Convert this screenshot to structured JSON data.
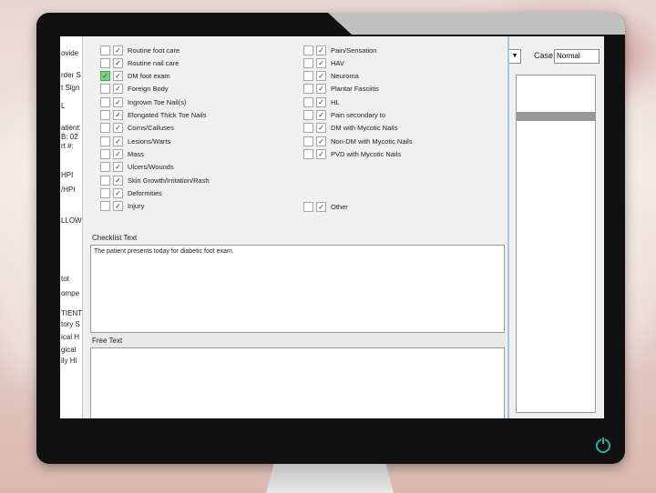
{
  "left_column": [
    {
      "label": "Routine foot care",
      "checked": true,
      "highlight": false
    },
    {
      "label": "Routine nail care",
      "checked": true,
      "highlight": false
    },
    {
      "label": "DM foot exam",
      "checked": true,
      "highlight": true
    },
    {
      "label": "Foreign Body",
      "checked": true,
      "highlight": false
    },
    {
      "label": "Ingrown Toe Nail(s)",
      "checked": true,
      "highlight": false
    },
    {
      "label": "Elongated Thick Toe Nails",
      "checked": true,
      "highlight": false
    },
    {
      "label": "Corns/Calluses",
      "checked": true,
      "highlight": false
    },
    {
      "label": "Lesions/Warts",
      "checked": true,
      "highlight": false
    },
    {
      "label": "Mass",
      "checked": true,
      "highlight": false
    },
    {
      "label": "Ulcers/Wounds",
      "checked": true,
      "highlight": false
    },
    {
      "label": "Skin Growth/Irritation/Rash",
      "checked": true,
      "highlight": false
    },
    {
      "label": "Deformities",
      "checked": true,
      "highlight": false
    },
    {
      "label": "Injury",
      "checked": true,
      "highlight": false
    }
  ],
  "right_column": [
    {
      "label": "Pain/Sensation",
      "checked": true
    },
    {
      "label": "HAV",
      "checked": true
    },
    {
      "label": "Neuroma",
      "checked": true
    },
    {
      "label": "Plantar Fasciitis",
      "checked": true
    },
    {
      "label": "HL",
      "checked": true
    },
    {
      "label": "Pain secondary to",
      "checked": true
    },
    {
      "label": "DM with Mycotic Nails",
      "checked": true
    },
    {
      "label": "Non-DM with Mycotic Nails",
      "checked": true
    },
    {
      "label": "PVD with Mycotic Nails",
      "checked": true
    }
  ],
  "other": {
    "label": "Other",
    "checked": true
  },
  "checklist_text": {
    "label": "Checklist Text",
    "value": "The patient presents today for diabetic foot exam."
  },
  "free_text": {
    "label": "Free Text",
    "value": ""
  },
  "case": {
    "label": "Case:",
    "value": "Normal"
  },
  "background_left_fragments": [
    "ovide",
    "rder S",
    "t Sign",
    "L",
    "atient:",
    "B: 02",
    "rt #:",
    "HPI",
    "/HPI",
    "LLOW",
    "tot",
    "ompe",
    "TIENT",
    "tory S",
    "ical H",
    "gical",
    "ily Hi"
  ],
  "colors": {
    "highlight_check": "#77d084",
    "dialog_bg": "#f0f0f0",
    "accent_border": "#a9c8d6",
    "power_led": "#27b3a5"
  }
}
